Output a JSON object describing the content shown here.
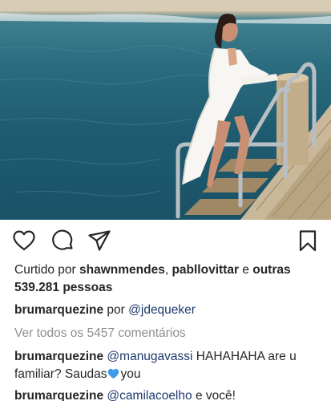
{
  "post": {
    "image_alt": "Mulher de roupão branco na escada de um píer à beira-mar",
    "likes": {
      "prefix": "Curtido por",
      "user1": "shawnmendes",
      "separator": ",",
      "user2": "pabllovittar",
      "conj": "e",
      "others_label": "outras",
      "count": "539.281 pessoas"
    },
    "caption": {
      "username": "brumarquezine",
      "by": "por",
      "credit": "@jdequeker"
    },
    "view_all_comments": "Ver todos os 5457 comentários",
    "comments": [
      {
        "username": "brumarquezine",
        "mention": "@manugavassi",
        "text_line1": "HAHAHAHA are u",
        "text_line2_a": "familiar? Saudas",
        "emoji": "blue-heart",
        "text_line2_b": "you"
      },
      {
        "username": "brumarquezine",
        "mention": "@camilacoelho",
        "text": "e você!"
      }
    ]
  },
  "icons": {
    "like": "heart-icon",
    "comment": "comment-icon",
    "share": "paper-plane-icon",
    "save": "bookmark-icon"
  },
  "colors": {
    "text": "#262626",
    "link": "#1e3a6e",
    "muted": "#8e8e8e",
    "heart_emoji": "#3d9be9"
  }
}
